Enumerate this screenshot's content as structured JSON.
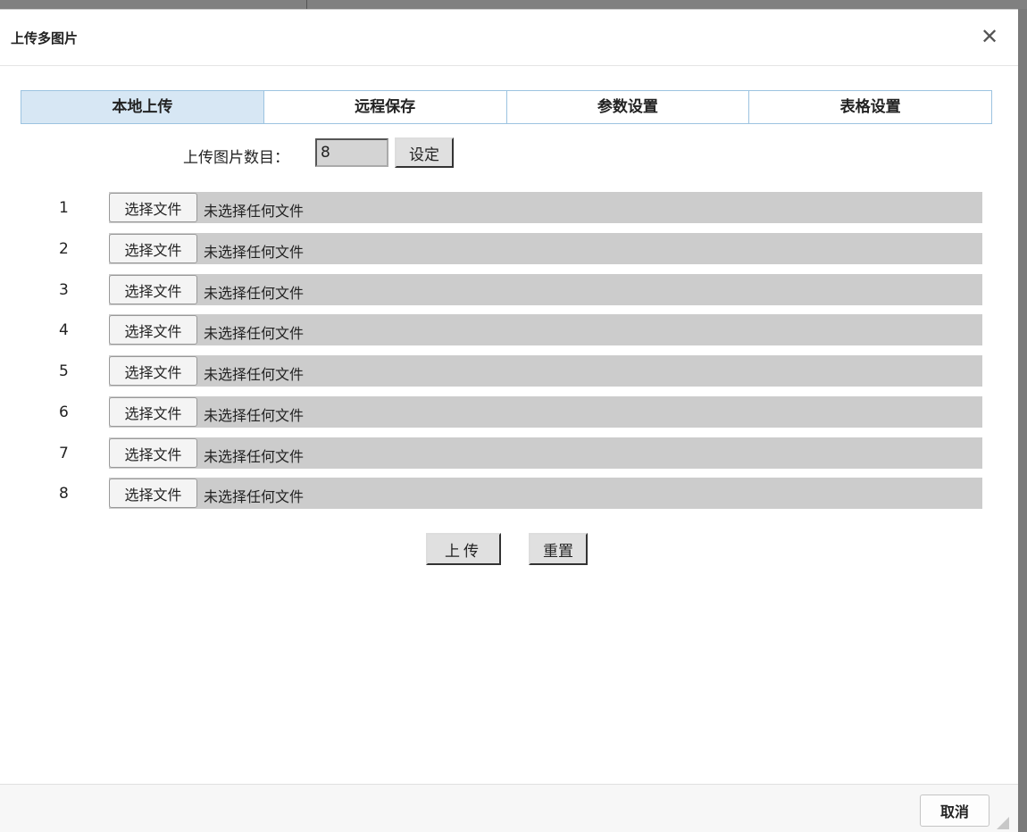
{
  "dialog": {
    "title": "上传多图片",
    "close_glyph": "✕",
    "close_icon": "close-icon"
  },
  "tabs": [
    {
      "label": "本地上传",
      "active": true
    },
    {
      "label": "远程保存",
      "active": false
    },
    {
      "label": "参数设置",
      "active": false
    },
    {
      "label": "表格设置",
      "active": false
    }
  ],
  "count": {
    "label": "上传图片数目：",
    "value": "8",
    "set_button": "设定"
  },
  "files": [
    {
      "index": "1",
      "button": "选择文件",
      "status": "未选择任何文件"
    },
    {
      "index": "2",
      "button": "选择文件",
      "status": "未选择任何文件"
    },
    {
      "index": "3",
      "button": "选择文件",
      "status": "未选择任何文件"
    },
    {
      "index": "4",
      "button": "选择文件",
      "status": "未选择任何文件"
    },
    {
      "index": "5",
      "button": "选择文件",
      "status": "未选择任何文件"
    },
    {
      "index": "6",
      "button": "选择文件",
      "status": "未选择任何文件"
    },
    {
      "index": "7",
      "button": "选择文件",
      "status": "未选择任何文件"
    },
    {
      "index": "8",
      "button": "选择文件",
      "status": "未选择任何文件"
    }
  ],
  "actions": {
    "upload": "上传",
    "reset": "重置"
  },
  "footer": {
    "cancel": "取消"
  },
  "colors": {
    "tab_active_bg": "#d7e7f4",
    "tab_border": "#9cc3e0",
    "file_field_bg": "#cccccc"
  }
}
